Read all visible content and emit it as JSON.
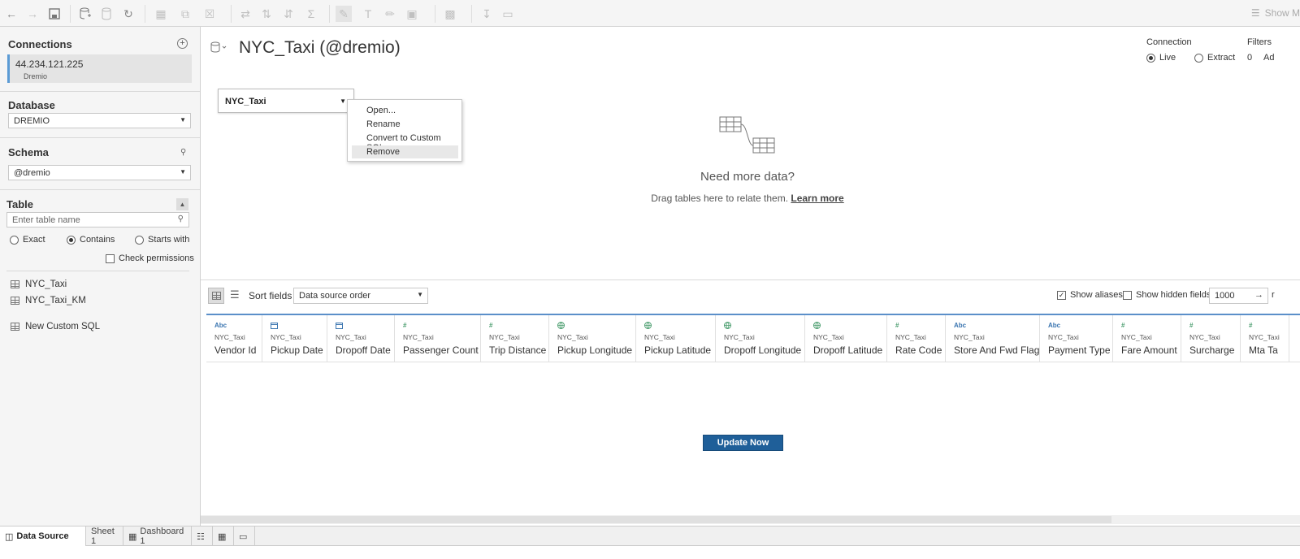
{
  "toolbar": {
    "show_me": "Show M"
  },
  "sidebar": {
    "connections_heading": "Connections",
    "connection": {
      "host": "44.234.121.225",
      "type": "Dremio"
    },
    "database_heading": "Database",
    "database_value": "DREMIO",
    "schema_heading": "Schema",
    "schema_value": "@dremio",
    "table_heading": "Table",
    "table_search_placeholder": "Enter table name",
    "match_options": [
      "Exact",
      "Contains",
      "Starts with"
    ],
    "check_permissions": "Check permissions",
    "tables": [
      "NYC_Taxi",
      "NYC_Taxi_KM"
    ],
    "new_custom_sql": "New Custom SQL"
  },
  "canvas": {
    "title": "NYC_Taxi (@dremio)",
    "connection_label": "Connection",
    "live_label": "Live",
    "extract_label": "Extract",
    "filters_label": "Filters",
    "filters_count": "0",
    "filters_add": "Ad",
    "table_pill": "NYC_Taxi",
    "context_menu": [
      "Open...",
      "Rename",
      "Convert to Custom SQL",
      "Remove"
    ],
    "need_more_title": "Need more data?",
    "need_more_text": "Drag tables here to relate them.",
    "learn_more": "Learn more"
  },
  "grid": {
    "sort_label": "Sort fields",
    "sort_value": "Data source order",
    "show_aliases": "Show aliases",
    "show_hidden": "Show hidden fields",
    "rows_value": "1000",
    "rows_suffix": "r",
    "columns": [
      {
        "type": "Abc",
        "source": "NYC_Taxi",
        "name": "Vendor Id"
      },
      {
        "type": "date",
        "source": "NYC_Taxi",
        "name": "Pickup Date"
      },
      {
        "type": "date",
        "source": "NYC_Taxi",
        "name": "Dropoff Date"
      },
      {
        "type": "#",
        "source": "NYC_Taxi",
        "name": "Passenger Count"
      },
      {
        "type": "#",
        "source": "NYC_Taxi",
        "name": "Trip Distance"
      },
      {
        "type": "geo",
        "source": "NYC_Taxi",
        "name": "Pickup Longitude"
      },
      {
        "type": "geo",
        "source": "NYC_Taxi",
        "name": "Pickup Latitude"
      },
      {
        "type": "geo",
        "source": "NYC_Taxi",
        "name": "Dropoff Longitude"
      },
      {
        "type": "geo",
        "source": "NYC_Taxi",
        "name": "Dropoff Latitude"
      },
      {
        "type": "#",
        "source": "NYC_Taxi",
        "name": "Rate Code"
      },
      {
        "type": "Abc",
        "source": "NYC_Taxi",
        "name": "Store And Fwd Flag"
      },
      {
        "type": "Abc",
        "source": "NYC_Taxi",
        "name": "Payment Type"
      },
      {
        "type": "#",
        "source": "NYC_Taxi",
        "name": "Fare Amount"
      },
      {
        "type": "#",
        "source": "NYC_Taxi",
        "name": "Surcharge"
      },
      {
        "type": "#",
        "source": "NYC_Taxi",
        "name": "Mta Ta"
      }
    ],
    "update_now": "Update Now"
  },
  "tabs": {
    "data_source": "Data Source",
    "sheet1": "Sheet 1",
    "dashboard1": "Dashboard 1"
  },
  "colors": {
    "accent": "#1f5f99",
    "header_line": "#5b8fc9",
    "selection": "#5b9bd5"
  }
}
